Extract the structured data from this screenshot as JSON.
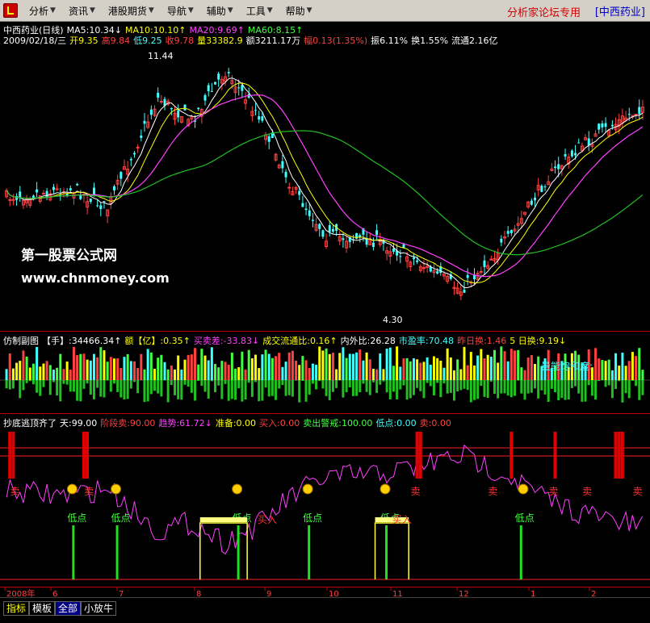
{
  "menu": {
    "items": [
      "分析",
      "资讯",
      "港股期货",
      "导航",
      "辅助",
      "工具",
      "帮助"
    ],
    "forum_text": "分析家论坛专用",
    "stock_bracket": "[中西药业]"
  },
  "main": {
    "row1": [
      {
        "t": "中西药业(日线)",
        "c": "#ffffff"
      },
      {
        "t": "MA5:10.34↓",
        "c": "#ffffff"
      },
      {
        "t": "MA10:10.10↑",
        "c": "#ffff00"
      },
      {
        "t": "MA20:9.69↑",
        "c": "#ff40ff"
      },
      {
        "t": "MA60:8.15↑",
        "c": "#40ff40"
      }
    ],
    "row2": [
      {
        "t": "2009/02/18/三",
        "c": "#ffffff"
      },
      {
        "t": "开9.35",
        "c": "#ffff00"
      },
      {
        "t": "高9.84",
        "c": "#ff4040"
      },
      {
        "t": "低9.25",
        "c": "#40ffff"
      },
      {
        "t": "收9.78",
        "c": "#ff4040"
      },
      {
        "t": "量33382.9",
        "c": "#ffff00"
      },
      {
        "t": "额3211.17万",
        "c": "#ffffff"
      },
      {
        "t": "幅0.13(1.35%)",
        "c": "#ff4040"
      },
      {
        "t": "振6.11%",
        "c": "#ffffff"
      },
      {
        "t": "换1.55%",
        "c": "#ffffff"
      },
      {
        "t": "流通2.16亿",
        "c": "#ffffff"
      }
    ],
    "high_label": "11.44",
    "low_label": "4.30",
    "watermark_1": "第一股票公式网",
    "watermark_2": "www.chnmoney.com"
  },
  "sub": {
    "row": [
      {
        "t": "仿制副图",
        "c": "#ffffff"
      },
      {
        "t": "【手】:34466.34↑",
        "c": "#ffffff"
      },
      {
        "t": "额【亿】:0.35↑",
        "c": "#ffff00"
      },
      {
        "t": "买卖差:-33.83↓",
        "c": "#ff40ff"
      },
      {
        "t": "成交流通比:0.16↑",
        "c": "#ffff00"
      },
      {
        "t": "内外比:26.28",
        "c": "#ffffff"
      },
      {
        "t": "市盈率:70.48",
        "c": "#40ffff"
      },
      {
        "t": "昨日换:1.46",
        "c": "#ff4040"
      },
      {
        "t": "5 日换:9.19↓",
        "c": "#ffff00"
      }
    ],
    "overlay": "量能饱和度:"
  },
  "ind": {
    "row": [
      {
        "t": "抄底逃顶齐了",
        "c": "#ffffff"
      },
      {
        "t": "天:99.00",
        "c": "#ffffff"
      },
      {
        "t": "阶段卖:90.00",
        "c": "#ff4040"
      },
      {
        "t": "趋势:61.72↓",
        "c": "#ff40ff"
      },
      {
        "t": "准备:0.00",
        "c": "#ffff00"
      },
      {
        "t": "买入:0.00",
        "c": "#ff4040"
      },
      {
        "t": "卖出警戒:100.00",
        "c": "#40ff40"
      },
      {
        "t": "低点:0.00",
        "c": "#40ffff"
      },
      {
        "t": "卖:0.00",
        "c": "#ff4040"
      }
    ],
    "sell_label": "卖",
    "low_label": "低点",
    "buy_label": "买入"
  },
  "axis": {
    "months": [
      "2008年",
      "6",
      "7",
      "8",
      "9",
      "10",
      "11",
      "12",
      "1",
      "2"
    ]
  },
  "tabs": [
    "指标",
    "模板",
    "全部",
    "小放牛"
  ],
  "colors": {
    "up": "#ff4040",
    "down": "#40ffff",
    "ma5": "#ffffff",
    "ma10": "#ffff00",
    "ma20": "#ff40ff",
    "ma60": "#20c020",
    "grid": "#c00000"
  }
}
